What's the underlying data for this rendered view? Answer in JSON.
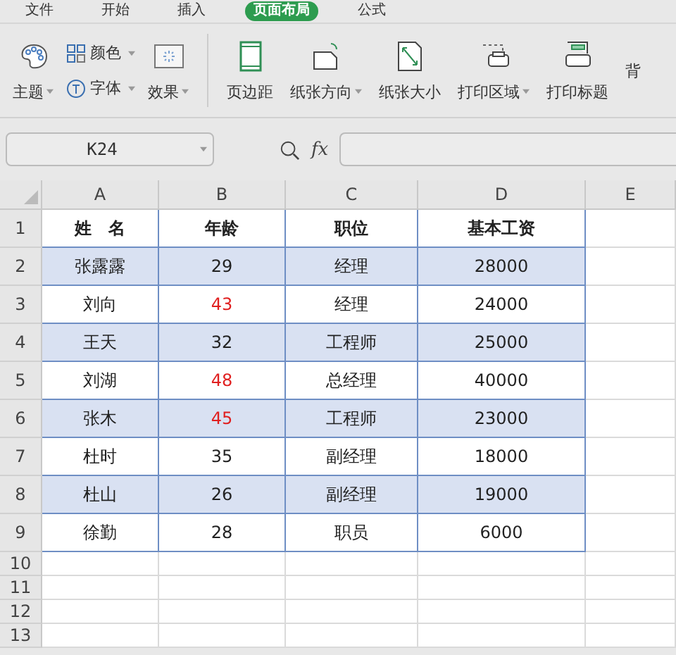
{
  "menu_tabs": [
    {
      "label": "文件",
      "selected": false
    },
    {
      "label": "开始",
      "selected": false
    },
    {
      "label": "插入",
      "selected": false
    },
    {
      "label": "页面布局",
      "selected": true
    },
    {
      "label": "公式",
      "selected": false
    }
  ],
  "ribbon": {
    "theme": {
      "label": "主题",
      "dropdown": true
    },
    "small_buttons": [
      {
        "kind": "colors",
        "label": "颜色",
        "dropdown": true
      },
      {
        "kind": "fonts",
        "label": "字体",
        "dropdown": true
      }
    ],
    "effects": {
      "label": "效果",
      "dropdown": true
    },
    "large_buttons": [
      {
        "kind": "margins",
        "label": "页边距",
        "dropdown": false
      },
      {
        "kind": "orientation",
        "label": "纸张方向",
        "dropdown": true
      },
      {
        "kind": "size",
        "label": "纸张大小",
        "dropdown": false
      },
      {
        "kind": "print_area",
        "label": "打印区域",
        "dropdown": true
      },
      {
        "kind": "print_titles",
        "label": "打印标题",
        "dropdown": false
      },
      {
        "kind": "background",
        "label": "背",
        "dropdown": false
      }
    ]
  },
  "name_box": {
    "value": "K24"
  },
  "formula_bar": {
    "fx": "fx"
  },
  "columns": [
    "A",
    "B",
    "C",
    "D",
    "E"
  ],
  "rows": [
    {
      "number": "1",
      "header": true,
      "highlight": false,
      "cells": [
        {
          "text": "姓　名"
        },
        {
          "text": "年龄"
        },
        {
          "text": "职位"
        },
        {
          "text": "基本工资"
        }
      ]
    },
    {
      "number": "2",
      "header": false,
      "highlight": true,
      "cells": [
        {
          "text": "张露露"
        },
        {
          "text": "29"
        },
        {
          "text": "经理"
        },
        {
          "text": "28000"
        }
      ]
    },
    {
      "number": "3",
      "header": false,
      "highlight": false,
      "cells": [
        {
          "text": "刘向"
        },
        {
          "text": "43",
          "color": "#e02020"
        },
        {
          "text": "经理"
        },
        {
          "text": "24000"
        }
      ]
    },
    {
      "number": "4",
      "header": false,
      "highlight": true,
      "cells": [
        {
          "text": "王天"
        },
        {
          "text": "32"
        },
        {
          "text": "工程师"
        },
        {
          "text": "25000"
        }
      ]
    },
    {
      "number": "5",
      "header": false,
      "highlight": false,
      "cells": [
        {
          "text": "刘湖"
        },
        {
          "text": "48",
          "color": "#e02020"
        },
        {
          "text": "总经理"
        },
        {
          "text": "40000"
        }
      ]
    },
    {
      "number": "6",
      "header": false,
      "highlight": true,
      "cells": [
        {
          "text": "张木"
        },
        {
          "text": "45",
          "color": "#e02020"
        },
        {
          "text": "工程师"
        },
        {
          "text": "23000"
        }
      ]
    },
    {
      "number": "7",
      "header": false,
      "highlight": false,
      "cells": [
        {
          "text": "杜时"
        },
        {
          "text": "35"
        },
        {
          "text": "副经理"
        },
        {
          "text": "18000"
        }
      ]
    },
    {
      "number": "8",
      "header": false,
      "highlight": true,
      "cells": [
        {
          "text": "杜山"
        },
        {
          "text": "26"
        },
        {
          "text": "副经理"
        },
        {
          "text": "19000"
        }
      ]
    },
    {
      "number": "9",
      "header": false,
      "highlight": false,
      "cells": [
        {
          "text": "徐勤"
        },
        {
          "text": "28"
        },
        {
          "text": "职员"
        },
        {
          "text": "6000"
        }
      ]
    }
  ],
  "empty_rows": [
    "10",
    "11",
    "12",
    "13"
  ]
}
